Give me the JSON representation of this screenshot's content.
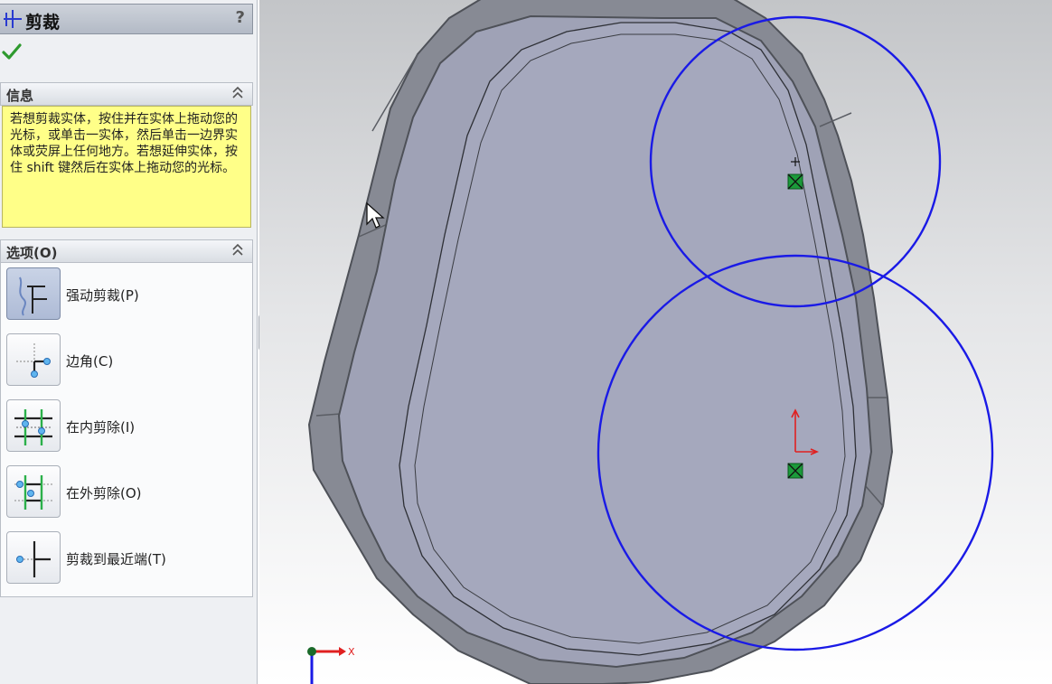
{
  "panel": {
    "title": "剪裁",
    "help": "?",
    "info": {
      "header": "信息",
      "text": "若想剪裁实体，按住并在实体上拖动您的光标，或单击一实体，然后单击一边界实体或荧屏上任何地方。若想延伸实体，按住 shift 键然后在实体上拖动您的光标。"
    },
    "options": {
      "header": "选项(O)",
      "items": [
        {
          "label": "强动剪裁(P)",
          "icon": "power-trim-icon",
          "selected": true
        },
        {
          "label": "边角(C)",
          "icon": "corner-trim-icon",
          "selected": false
        },
        {
          "label": "在内剪除(I)",
          "icon": "trim-away-inside-icon",
          "selected": false
        },
        {
          "label": "在外剪除(O)",
          "icon": "trim-away-outside-icon",
          "selected": false
        },
        {
          "label": "剪裁到最近端(T)",
          "icon": "trim-to-closest-icon",
          "selected": false
        }
      ]
    }
  },
  "viewport": {
    "axis_label": "X"
  },
  "colors": {
    "sketch_line": "#1a1ae6",
    "info_bg": "#ffff88",
    "model_face": "#a5a8bd",
    "model_edge": "#5e6169"
  }
}
